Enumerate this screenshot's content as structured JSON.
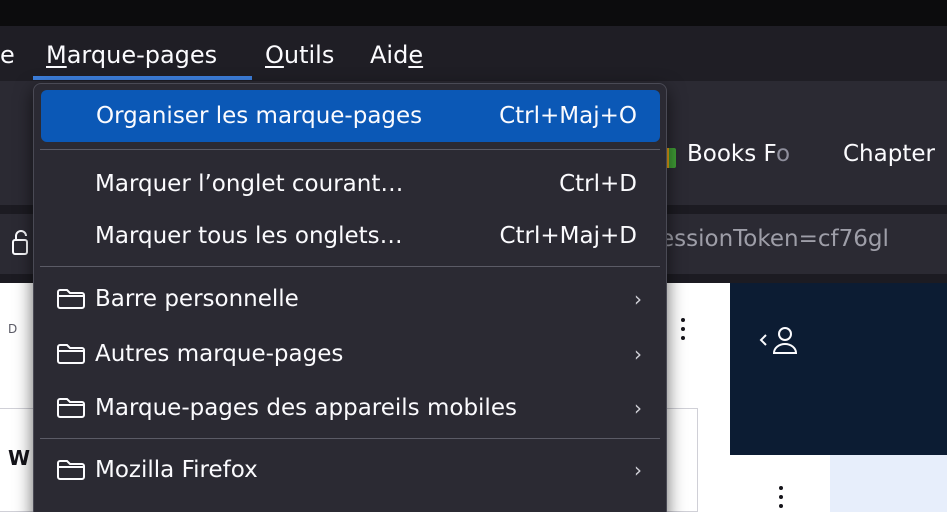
{
  "menubar": {
    "items": [
      {
        "label": "e",
        "accel_index": -1
      },
      {
        "label": "Marque-pages",
        "accel_index": 0
      },
      {
        "label": "Outils",
        "accel_index": 0
      },
      {
        "label": "Aide",
        "accel_index": 3
      }
    ]
  },
  "bookmarks_toolbar": {
    "items": [
      {
        "label": "Books F",
        "faded": "o"
      },
      {
        "label": "Chapter"
      }
    ]
  },
  "urlbar": {
    "text": "essionToken=cf76gl"
  },
  "page": {
    "card_letter": "W",
    "small_letter": "D"
  },
  "dropdown": {
    "organize": {
      "label": "Organiser les marque-pages",
      "shortcut": "Ctrl+Maj+O"
    },
    "bookmark_current": {
      "label": "Marquer l’onglet courant…",
      "shortcut": "Ctrl+D"
    },
    "bookmark_all": {
      "label": "Marquer tous les onglets…",
      "shortcut": "Ctrl+Maj+D"
    },
    "folders": [
      {
        "label": "Barre personnelle",
        "icon": "folder-icon"
      },
      {
        "label": "Autres marque-pages",
        "icon": "folder-icon"
      },
      {
        "label": "Marque-pages des appareils mobiles",
        "icon": "folder-icon"
      },
      {
        "label": "Mozilla Firefox",
        "icon": "folder-icon"
      }
    ],
    "arrow_glyph": "›"
  },
  "colors": {
    "highlight": "#0b58b6",
    "menu_bg": "#2b2a33",
    "active_underline": "#3d7fdc"
  }
}
